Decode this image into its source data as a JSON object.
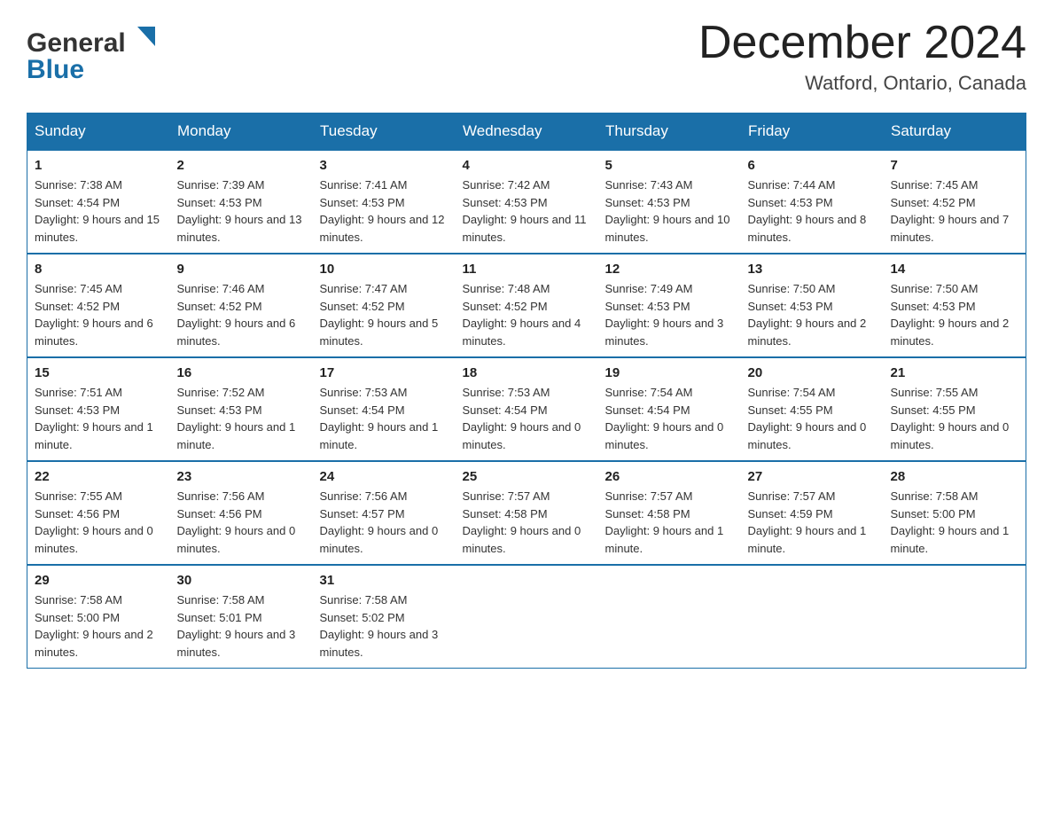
{
  "header": {
    "title": "December 2024",
    "subtitle": "Watford, Ontario, Canada"
  },
  "logo": {
    "general": "General",
    "blue": "Blue"
  },
  "days_header": [
    "Sunday",
    "Monday",
    "Tuesday",
    "Wednesday",
    "Thursday",
    "Friday",
    "Saturday"
  ],
  "weeks": [
    [
      {
        "day": "1",
        "sunrise": "7:38 AM",
        "sunset": "4:54 PM",
        "daylight": "9 hours and 15 minutes."
      },
      {
        "day": "2",
        "sunrise": "7:39 AM",
        "sunset": "4:53 PM",
        "daylight": "9 hours and 13 minutes."
      },
      {
        "day": "3",
        "sunrise": "7:41 AM",
        "sunset": "4:53 PM",
        "daylight": "9 hours and 12 minutes."
      },
      {
        "day": "4",
        "sunrise": "7:42 AM",
        "sunset": "4:53 PM",
        "daylight": "9 hours and 11 minutes."
      },
      {
        "day": "5",
        "sunrise": "7:43 AM",
        "sunset": "4:53 PM",
        "daylight": "9 hours and 10 minutes."
      },
      {
        "day": "6",
        "sunrise": "7:44 AM",
        "sunset": "4:53 PM",
        "daylight": "9 hours and 8 minutes."
      },
      {
        "day": "7",
        "sunrise": "7:45 AM",
        "sunset": "4:52 PM",
        "daylight": "9 hours and 7 minutes."
      }
    ],
    [
      {
        "day": "8",
        "sunrise": "7:45 AM",
        "sunset": "4:52 PM",
        "daylight": "9 hours and 6 minutes."
      },
      {
        "day": "9",
        "sunrise": "7:46 AM",
        "sunset": "4:52 PM",
        "daylight": "9 hours and 6 minutes."
      },
      {
        "day": "10",
        "sunrise": "7:47 AM",
        "sunset": "4:52 PM",
        "daylight": "9 hours and 5 minutes."
      },
      {
        "day": "11",
        "sunrise": "7:48 AM",
        "sunset": "4:52 PM",
        "daylight": "9 hours and 4 minutes."
      },
      {
        "day": "12",
        "sunrise": "7:49 AM",
        "sunset": "4:53 PM",
        "daylight": "9 hours and 3 minutes."
      },
      {
        "day": "13",
        "sunrise": "7:50 AM",
        "sunset": "4:53 PM",
        "daylight": "9 hours and 2 minutes."
      },
      {
        "day": "14",
        "sunrise": "7:50 AM",
        "sunset": "4:53 PM",
        "daylight": "9 hours and 2 minutes."
      }
    ],
    [
      {
        "day": "15",
        "sunrise": "7:51 AM",
        "sunset": "4:53 PM",
        "daylight": "9 hours and 1 minute."
      },
      {
        "day": "16",
        "sunrise": "7:52 AM",
        "sunset": "4:53 PM",
        "daylight": "9 hours and 1 minute."
      },
      {
        "day": "17",
        "sunrise": "7:53 AM",
        "sunset": "4:54 PM",
        "daylight": "9 hours and 1 minute."
      },
      {
        "day": "18",
        "sunrise": "7:53 AM",
        "sunset": "4:54 PM",
        "daylight": "9 hours and 0 minutes."
      },
      {
        "day": "19",
        "sunrise": "7:54 AM",
        "sunset": "4:54 PM",
        "daylight": "9 hours and 0 minutes."
      },
      {
        "day": "20",
        "sunrise": "7:54 AM",
        "sunset": "4:55 PM",
        "daylight": "9 hours and 0 minutes."
      },
      {
        "day": "21",
        "sunrise": "7:55 AM",
        "sunset": "4:55 PM",
        "daylight": "9 hours and 0 minutes."
      }
    ],
    [
      {
        "day": "22",
        "sunrise": "7:55 AM",
        "sunset": "4:56 PM",
        "daylight": "9 hours and 0 minutes."
      },
      {
        "day": "23",
        "sunrise": "7:56 AM",
        "sunset": "4:56 PM",
        "daylight": "9 hours and 0 minutes."
      },
      {
        "day": "24",
        "sunrise": "7:56 AM",
        "sunset": "4:57 PM",
        "daylight": "9 hours and 0 minutes."
      },
      {
        "day": "25",
        "sunrise": "7:57 AM",
        "sunset": "4:58 PM",
        "daylight": "9 hours and 0 minutes."
      },
      {
        "day": "26",
        "sunrise": "7:57 AM",
        "sunset": "4:58 PM",
        "daylight": "9 hours and 1 minute."
      },
      {
        "day": "27",
        "sunrise": "7:57 AM",
        "sunset": "4:59 PM",
        "daylight": "9 hours and 1 minute."
      },
      {
        "day": "28",
        "sunrise": "7:58 AM",
        "sunset": "5:00 PM",
        "daylight": "9 hours and 1 minute."
      }
    ],
    [
      {
        "day": "29",
        "sunrise": "7:58 AM",
        "sunset": "5:00 PM",
        "daylight": "9 hours and 2 minutes."
      },
      {
        "day": "30",
        "sunrise": "7:58 AM",
        "sunset": "5:01 PM",
        "daylight": "9 hours and 3 minutes."
      },
      {
        "day": "31",
        "sunrise": "7:58 AM",
        "sunset": "5:02 PM",
        "daylight": "9 hours and 3 minutes."
      },
      null,
      null,
      null,
      null
    ]
  ],
  "labels": {
    "sunrise": "Sunrise: ",
    "sunset": "Sunset: ",
    "daylight": "Daylight: "
  }
}
